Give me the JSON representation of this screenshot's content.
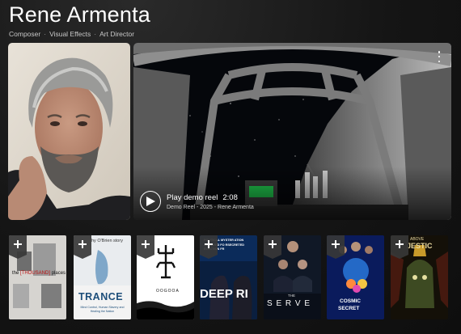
{
  "profile": {
    "name": "Rene Armenta",
    "roles": [
      "Composer",
      "Visual Effects",
      "Art Director"
    ],
    "separator": "·"
  },
  "video": {
    "title": "Play demo reel",
    "duration": "2:08",
    "subtitle": "Demo Reel - 2025 - Rene Armenta"
  },
  "credits": [
    {
      "label": "the [THOUSAND] places",
      "parts": [
        "the",
        "[THOUSAND]",
        "places"
      ]
    },
    {
      "label": "TRANCE",
      "top": "hy O'Brien story",
      "sub": "Mind Control, Human Slavery and Healing the Nation"
    },
    {
      "label": "OOGOOA"
    },
    {
      "label": "DEEP RIG",
      "top": "POLITICAL MYSTER ATION ALLOWED FO RSECRETED ELECTION FR",
      "title": "DEEP RI"
    },
    {
      "label": "THE SERVE",
      "small": "THE",
      "title": "S E R V E"
    },
    {
      "label": "COSMIC SECRET",
      "title1": "COSMIC",
      "title2": "SECRET"
    },
    {
      "label": "ABOVE MAJESTIC",
      "title1": "ABOVE",
      "title2": "JESTIC"
    }
  ]
}
